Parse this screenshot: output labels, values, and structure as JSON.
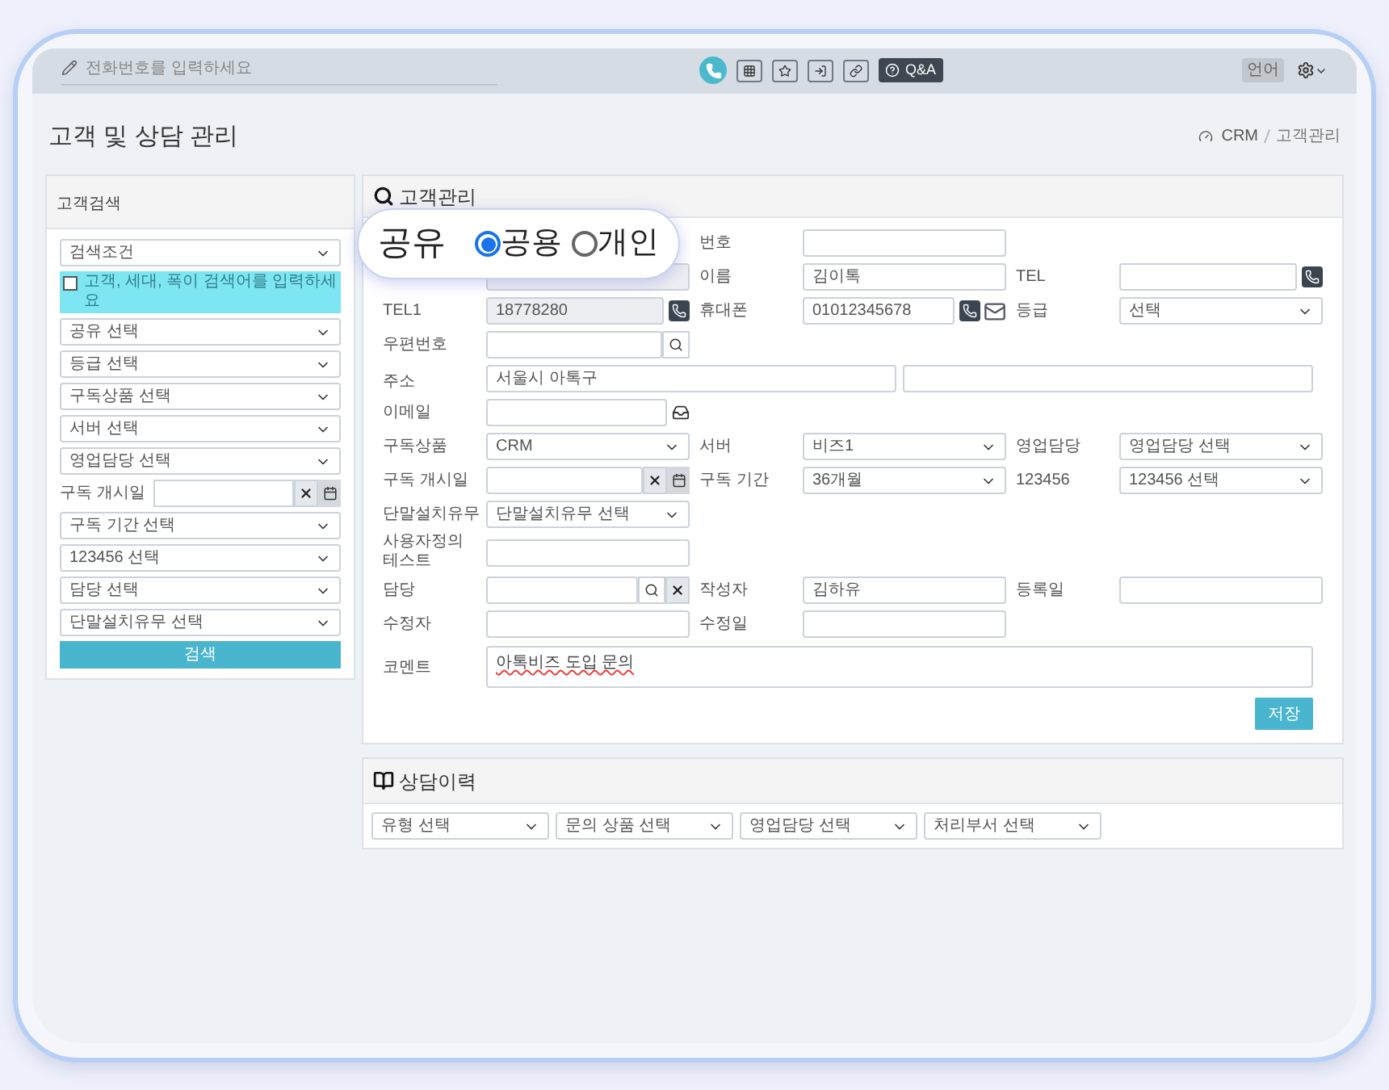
{
  "topbar": {
    "phone_placeholder": "전화번호를 입력하세요",
    "qa_button": "Q&A",
    "language": "언어"
  },
  "page": {
    "title": "고객 및 상담 관리",
    "breadcrumb": [
      "CRM",
      "고객관리"
    ]
  },
  "search_panel": {
    "title": "고객검색",
    "filters": [
      {
        "kind": "select",
        "value": "검색조건"
      },
      {
        "kind": "check",
        "placeholder": "고객, 세대, 폭이 검색어를 입력하세요",
        "checked": false
      },
      {
        "kind": "select",
        "value": "공유 선택"
      },
      {
        "kind": "select",
        "value": "등급 선택"
      },
      {
        "kind": "select",
        "value": "구독상품 선택"
      },
      {
        "kind": "select",
        "value": "서버 선택"
      },
      {
        "kind": "select",
        "value": "영업담당 선택"
      },
      {
        "kind": "date",
        "label": "구독 개시일"
      },
      {
        "kind": "select",
        "value": "구독 기간 선택"
      },
      {
        "kind": "select",
        "value": "123456 선택"
      },
      {
        "kind": "select",
        "value": "담당 선택"
      },
      {
        "kind": "select",
        "value": "단말설치유무 선택"
      }
    ],
    "button": "검색"
  },
  "customer_panel": {
    "title": "고객관리",
    "share_popup": {
      "label": "공유",
      "options": [
        {
          "label": "공용",
          "selected": true
        },
        {
          "label": "개인",
          "selected": false
        }
      ]
    },
    "rows": [
      {
        "kind": "normal",
        "cells": [
          {},
          {
            "label": "번호",
            "field": {
              "kind": "input"
            }
          }
        ]
      },
      {
        "kind": "normal",
        "cells": [
          {
            "field": {
              "kind": "input",
              "readonly": true
            }
          },
          {
            "label": "이름",
            "field": {
              "kind": "input",
              "value": "김이톡"
            }
          },
          {
            "label": "TEL",
            "field": {
              "kind": "input"
            },
            "addons": [
              {
                "kind": "phone"
              }
            ]
          }
        ]
      },
      {
        "kind": "normal",
        "cells": [
          {
            "label": "TEL1",
            "field": {
              "kind": "input",
              "value": "18778280",
              "readonly": true
            },
            "addons": [
              {
                "kind": "phone"
              }
            ]
          },
          {
            "label": "휴대폰",
            "field": {
              "kind": "input",
              "value": "01012345678"
            },
            "addons": [
              {
                "kind": "phone"
              },
              {
                "kind": "mail"
              }
            ]
          },
          {
            "label": "등급",
            "field": {
              "kind": "select",
              "value": "선택"
            }
          }
        ]
      },
      {
        "kind": "normal",
        "cells": [
          {
            "label": "우편번호",
            "field": {
              "kind": "input"
            },
            "addons": [
              {
                "kind": "search"
              }
            ]
          }
        ]
      },
      {
        "kind": "wide",
        "label": "주소",
        "fields": [
          {
            "kind": "input",
            "value": "서울시 아톡구"
          },
          {
            "kind": "input"
          }
        ]
      },
      {
        "kind": "normal",
        "cells": [
          {
            "label": "이메일",
            "field": {
              "kind": "input"
            },
            "addons": [
              {
                "kind": "inbox"
              }
            ]
          }
        ]
      },
      {
        "kind": "normal",
        "cells": [
          {
            "label": "구독상품",
            "field": {
              "kind": "select",
              "value": "CRM"
            }
          },
          {
            "label": "서버",
            "field": {
              "kind": "select",
              "value": "비즈1"
            }
          },
          {
            "label": "영업담당",
            "field": {
              "kind": "select",
              "value": "영업담당 선택"
            }
          }
        ]
      },
      {
        "kind": "normal",
        "cells": [
          {
            "label": "구독 개시일",
            "field": {
              "kind": "input"
            },
            "addons": [
              {
                "kind": "clear"
              },
              {
                "kind": "calendar"
              }
            ]
          },
          {
            "label": "구독 기간",
            "field": {
              "kind": "select",
              "value": "36개월"
            }
          },
          {
            "label": "123456",
            "field": {
              "kind": "select",
              "value": "123456 선택"
            }
          }
        ]
      },
      {
        "kind": "normal",
        "cells": [
          {
            "label": "단말설치유무",
            "field": {
              "kind": "select",
              "value": "단말설치유무 선택"
            }
          }
        ]
      },
      {
        "kind": "normal",
        "cells": [
          {
            "label": "사용자정의 테스트",
            "field": {
              "kind": "input"
            }
          }
        ]
      },
      {
        "kind": "normal",
        "cells": [
          {
            "label": "담당",
            "field": {
              "kind": "input"
            },
            "addons": [
              {
                "kind": "search"
              },
              {
                "kind": "clear"
              }
            ]
          },
          {
            "label": "작성자",
            "field": {
              "kind": "input",
              "value": "김하유"
            }
          },
          {
            "label": "등록일",
            "field": {
              "kind": "input"
            }
          }
        ]
      },
      {
        "kind": "normal",
        "cells": [
          {
            "label": "수정자",
            "field": {
              "kind": "input"
            }
          },
          {
            "label": "수정일",
            "field": {
              "kind": "input"
            }
          }
        ]
      },
      {
        "kind": "comment",
        "label": "코멘트",
        "value": "아톡비즈 도입 문의"
      }
    ],
    "save_button": "저장"
  },
  "history_panel": {
    "title": "상담이력",
    "filters": [
      "유형 선택",
      "문의 상품 선택",
      "영업담당 선택",
      "처리부서 선택"
    ]
  }
}
